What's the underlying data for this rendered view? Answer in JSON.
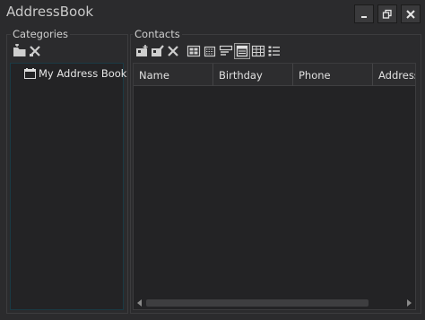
{
  "window": {
    "title": "AddressBook",
    "controls": {
      "minimize": "minimize",
      "restore": "restore",
      "close": "close"
    }
  },
  "categories": {
    "label": "Categories",
    "toolbar": [
      "add-category-icon",
      "delete-category-icon"
    ],
    "tree": [
      {
        "label": "My Address Book",
        "icon": "address-book-icon"
      }
    ]
  },
  "contacts": {
    "label": "Contacts",
    "toolbar": [
      "add-contact-icon",
      "edit-contact-icon",
      "delete-contact-icon",
      "large-icons-view-icon",
      "small-icons-view-icon",
      "list-view-icon",
      "details-view-icon",
      "grid-view-icon",
      "tile-view-icon"
    ],
    "columns": [
      "Name",
      "Birthday",
      "Phone",
      "Address"
    ],
    "rows": []
  },
  "colors": {
    "background": "#2b2b2d",
    "panel": "#232325",
    "accent_border": "#1a3a44"
  }
}
